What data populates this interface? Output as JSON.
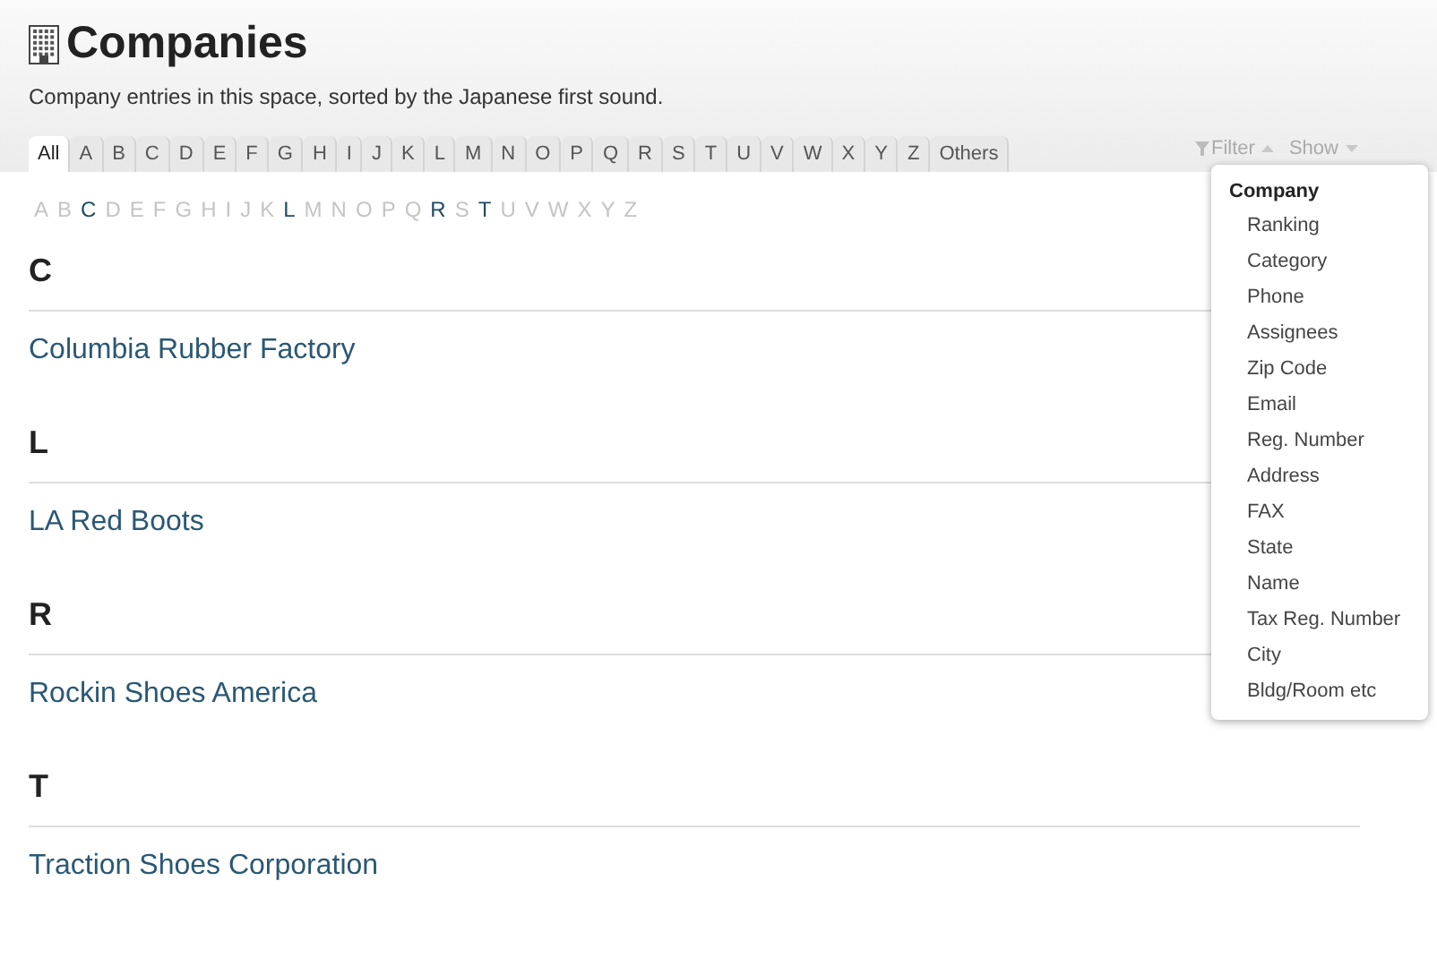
{
  "title": "Companies",
  "description": "Company entries in this space, sorted by the Japanese first sound.",
  "tabs": [
    {
      "label": "All",
      "selected": true
    },
    {
      "label": "A",
      "selected": false
    },
    {
      "label": "B",
      "selected": false
    },
    {
      "label": "C",
      "selected": false
    },
    {
      "label": "D",
      "selected": false
    },
    {
      "label": "E",
      "selected": false
    },
    {
      "label": "F",
      "selected": false
    },
    {
      "label": "G",
      "selected": false
    },
    {
      "label": "H",
      "selected": false
    },
    {
      "label": "I",
      "selected": false
    },
    {
      "label": "J",
      "selected": false
    },
    {
      "label": "K",
      "selected": false
    },
    {
      "label": "L",
      "selected": false
    },
    {
      "label": "M",
      "selected": false
    },
    {
      "label": "N",
      "selected": false
    },
    {
      "label": "O",
      "selected": false
    },
    {
      "label": "P",
      "selected": false
    },
    {
      "label": "Q",
      "selected": false
    },
    {
      "label": "R",
      "selected": false
    },
    {
      "label": "S",
      "selected": false
    },
    {
      "label": "T",
      "selected": false
    },
    {
      "label": "U",
      "selected": false
    },
    {
      "label": "V",
      "selected": false
    },
    {
      "label": "W",
      "selected": false
    },
    {
      "label": "X",
      "selected": false
    },
    {
      "label": "Y",
      "selected": false
    },
    {
      "label": "Z",
      "selected": false
    },
    {
      "label": "Others",
      "selected": false
    }
  ],
  "toolbar": {
    "filter": {
      "label": "Filter",
      "expanded": true
    },
    "show": {
      "label": "Show",
      "expanded": false
    }
  },
  "index": [
    {
      "letter": "A",
      "disabled": true
    },
    {
      "letter": "B",
      "disabled": true
    },
    {
      "letter": "C",
      "disabled": false
    },
    {
      "letter": "D",
      "disabled": true
    },
    {
      "letter": "E",
      "disabled": true
    },
    {
      "letter": "F",
      "disabled": true
    },
    {
      "letter": "G",
      "disabled": true
    },
    {
      "letter": "H",
      "disabled": true
    },
    {
      "letter": "I",
      "disabled": true
    },
    {
      "letter": "J",
      "disabled": true
    },
    {
      "letter": "K",
      "disabled": true
    },
    {
      "letter": "L",
      "disabled": false
    },
    {
      "letter": "M",
      "disabled": true
    },
    {
      "letter": "N",
      "disabled": true
    },
    {
      "letter": "O",
      "disabled": true
    },
    {
      "letter": "P",
      "disabled": true
    },
    {
      "letter": "Q",
      "disabled": true
    },
    {
      "letter": "R",
      "disabled": false
    },
    {
      "letter": "S",
      "disabled": true
    },
    {
      "letter": "T",
      "disabled": false
    },
    {
      "letter": "U",
      "disabled": true
    },
    {
      "letter": "V",
      "disabled": true
    },
    {
      "letter": "W",
      "disabled": true
    },
    {
      "letter": "X",
      "disabled": true
    },
    {
      "letter": "Y",
      "disabled": true
    },
    {
      "letter": "Z",
      "disabled": true
    }
  ],
  "sections": [
    {
      "heading": "C",
      "entries": [
        "Columbia Rubber Factory"
      ]
    },
    {
      "heading": "L",
      "entries": [
        "LA Red Boots"
      ]
    },
    {
      "heading": "R",
      "entries": [
        "Rockin Shoes America"
      ]
    },
    {
      "heading": "T",
      "entries": [
        "Traction Shoes Corporation"
      ]
    }
  ],
  "filter_menu": {
    "group": "Company",
    "items": [
      "Ranking",
      "Category",
      "Phone",
      "Assignees",
      "Zip Code",
      "Email",
      "Reg. Number",
      "Address",
      "FAX",
      "State",
      "Name",
      "Tax Reg. Number",
      "City",
      "Bldg/Room etc"
    ]
  }
}
